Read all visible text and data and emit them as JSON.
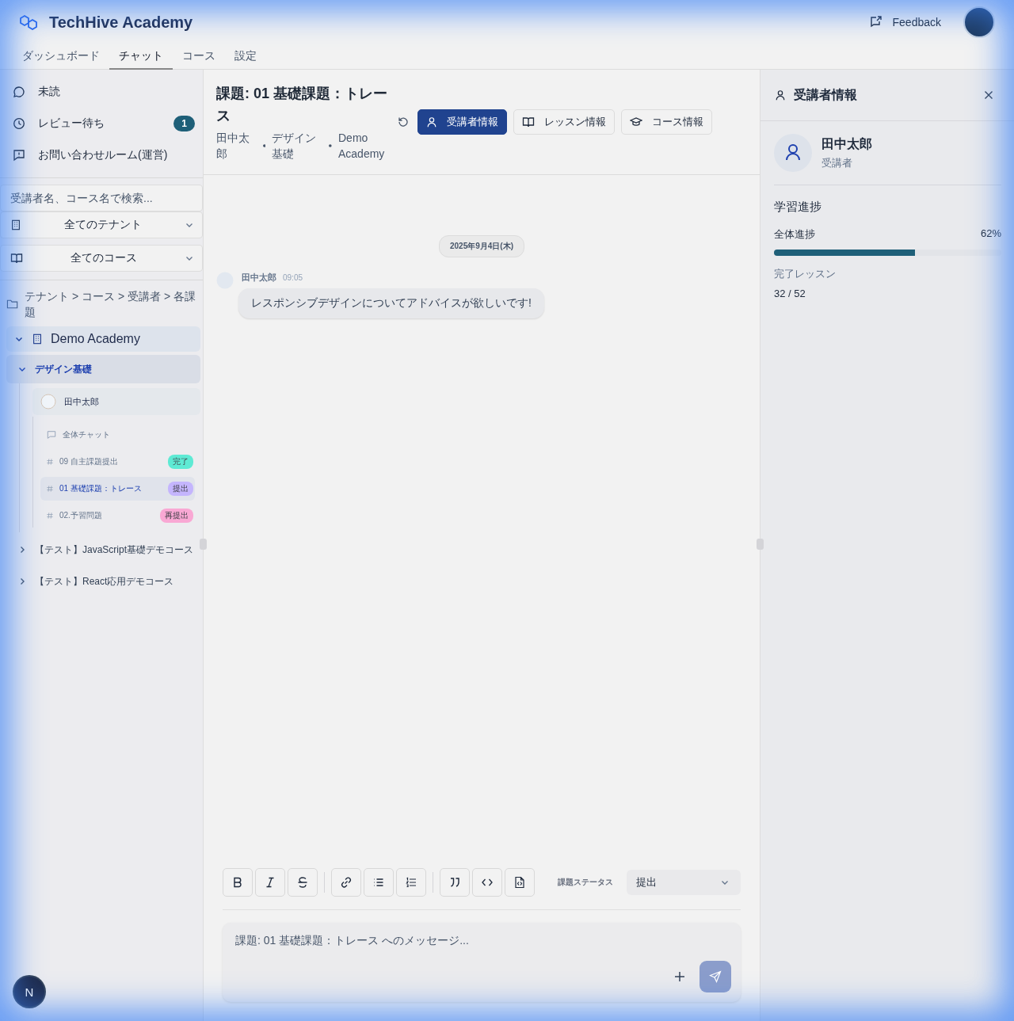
{
  "app": {
    "title": "TechHive Academy",
    "feedback": "Feedback"
  },
  "nav_tabs": [
    {
      "label": "ダッシュボード",
      "selected": false
    },
    {
      "label": "チャット",
      "selected": true
    },
    {
      "label": "コース",
      "selected": false
    },
    {
      "label": "設定",
      "selected": false
    }
  ],
  "sidebar": {
    "quick_items": [
      {
        "label": "未読"
      },
      {
        "label": "レビュー待ち",
        "badge": "1"
      },
      {
        "label": "お問い合わせルーム(運営)"
      }
    ],
    "search": {
      "placeholder": "受講者名、コース名で検索..."
    },
    "filters": [
      {
        "value": "全てのテナント"
      },
      {
        "value": "全てのコース"
      }
    ],
    "tree_hint": "テナント > コース > 受講者 > 各課題",
    "tree": [
      {
        "label": "Demo Academy",
        "kind": "tenant",
        "expanded": true,
        "children": [
          {
            "label": "デザイン基礎",
            "kind": "course",
            "expanded": true,
            "selected": true,
            "children": [
              {
                "label": "田中太郎",
                "kind": "student",
                "children": [
                  {
                    "label": "全体チャット",
                    "kind": "chat",
                    "selected": false
                  },
                  {
                    "label": "09 自主課題提出",
                    "kind": "assignment",
                    "selected": false,
                    "status": "完了",
                    "color": "#5eead4"
                  },
                  {
                    "label": "01 基礎課題：トレース",
                    "kind": "assignment",
                    "selected": true,
                    "status": "提出",
                    "color": "#c4b5fd"
                  },
                  {
                    "label": "02.予習問題",
                    "kind": "assignment",
                    "selected": false,
                    "status": "再提出",
                    "color": "#f9a8d4"
                  }
                ]
              }
            ]
          },
          {
            "label": "【テスト】JavaScript基礎デモコース",
            "kind": "course",
            "expanded": false,
            "selected": false
          },
          {
            "label": "【テスト】React応用デモコース",
            "kind": "course",
            "expanded": false,
            "selected": false
          }
        ]
      }
    ],
    "user_initial": "N"
  },
  "chat": {
    "title": "課題: 01 基礎課題：トレース",
    "meta": [
      "田中太郎",
      "デザイン基礎",
      "Demo Academy"
    ],
    "info_buttons": [
      {
        "label": "受講者情報",
        "selected": true
      },
      {
        "label": "レッスン情報",
        "selected": false
      },
      {
        "label": "コース情報",
        "selected": false
      }
    ],
    "date": "2025年9月4日(木)",
    "messages": [
      {
        "author": "田中太郎",
        "time": "09:05",
        "text": "レスポンシブデザインについてアドバイスが欲しいです!"
      }
    ],
    "status_label": "課題ステータス",
    "status_value": "提出",
    "placeholder": "課題: 01 基礎課題：トレース へのメッセージ..."
  },
  "info_panel": {
    "title": "受講者情報",
    "name": "田中太郎",
    "role": "受講者",
    "section": "学習進捗",
    "progress": {
      "label": "全体進捗",
      "reading": "62%",
      "level": 0.62
    },
    "completed_label": "完了レッスン",
    "completed_value": "32 / 52"
  }
}
